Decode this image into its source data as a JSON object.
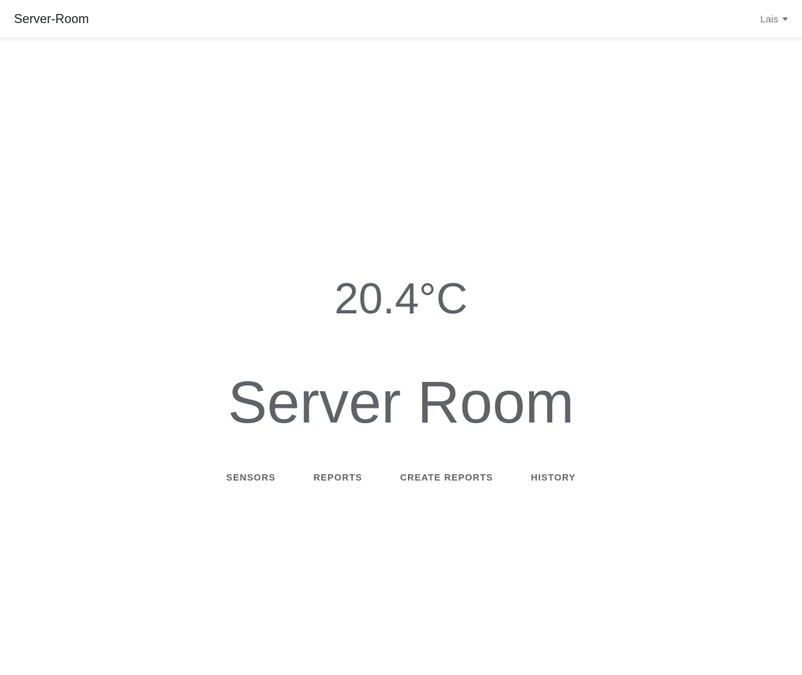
{
  "navbar": {
    "brand": "Server-Room",
    "user": "Lais"
  },
  "main": {
    "temperature": "20.4°C",
    "title": "Server Room"
  },
  "links": [
    "SENSORS",
    "REPORTS",
    "CREATE REPORTS",
    "HISTORY"
  ]
}
